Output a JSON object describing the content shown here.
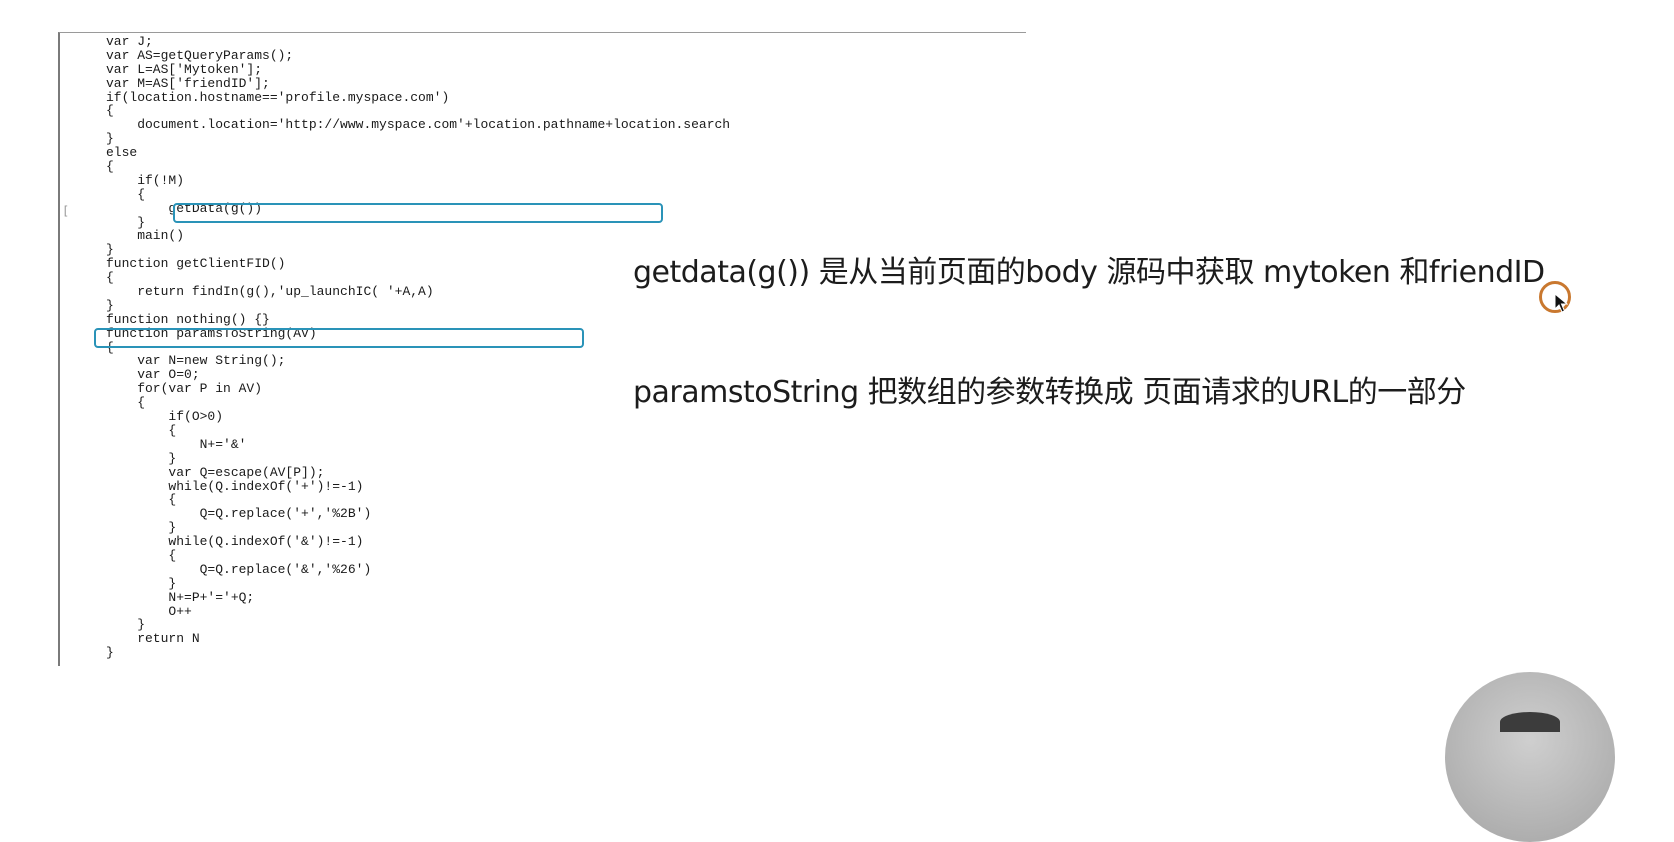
{
  "code": {
    "lines": [
      "var J;",
      "var AS=getQueryParams();",
      "var L=AS['Mytoken'];",
      "var M=AS['friendID'];",
      "if(location.hostname=='profile.myspace.com')",
      "{",
      "    document.location='http://www.myspace.com'+location.pathname+location.search",
      "}",
      "else",
      "{",
      "    if(!M)",
      "    {",
      "        getData(g())",
      "    }",
      "    main()",
      "}",
      "function getClientFID()",
      "{",
      "    return findIn(g(),'up_launchIC( '+A,A)",
      "}",
      "function nothing() {}",
      "function paramsToString(AV)",
      "{",
      "    var N=new String();",
      "    var O=0;",
      "    for(var P in AV)",
      "    {",
      "        if(O>0)",
      "        {",
      "            N+='&'",
      "        }",
      "        var Q=escape(AV[P]);",
      "        while(Q.indexOf('+')!=-1)",
      "        {",
      "            Q=Q.replace('+','%2B')",
      "        }",
      "        while(Q.indexOf('&')!=-1)",
      "        {",
      "            Q=Q.replace('&','%26')",
      "        }",
      "        N+=P+'='+Q;",
      "        O++",
      "    }",
      "    return N",
      "}"
    ],
    "gutter_mark": "["
  },
  "annotations": {
    "note_getdata": "getdata(g()) 是从当前页面的body 源码中获取 mytoken 和friendID",
    "note_params": "paramstoString  把数组的参数转换成 页面请求的URL的一部分"
  },
  "colors": {
    "highlight_border": "#2a93b8",
    "cursor_ring": "#c9782f",
    "code_text": "#1a1a1a"
  },
  "icons": {
    "cursor": "mouse-pointer-icon",
    "webcam": "webcam-avatar"
  }
}
